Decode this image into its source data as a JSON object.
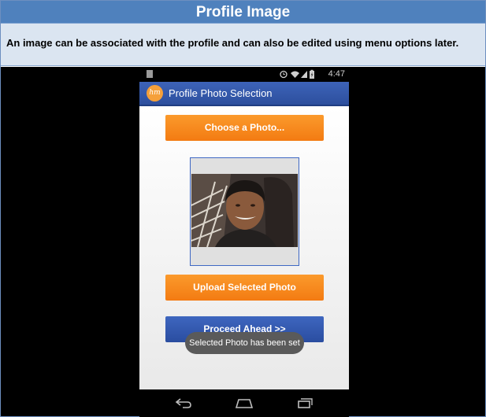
{
  "header": {
    "title": "Profile Image",
    "description": "An image can be associated with the profile and can also be edited using menu options later."
  },
  "status_bar": {
    "time": "4:47"
  },
  "app": {
    "logo_text": "hm",
    "title": "Profile Photo Selection",
    "choose_button_label": "Choose a Photo...",
    "upload_button_label": "Upload Selected Photo",
    "proceed_button_label": "Proceed Ahead >>",
    "toast_message": "Selected Photo has been set"
  },
  "icons": {
    "status": [
      "notification-icon",
      "alarm-icon",
      "wifi-icon",
      "signal-icon",
      "battery-icon"
    ],
    "nav": [
      "back-icon",
      "home-icon",
      "recent-apps-icon"
    ]
  },
  "colors": {
    "header_bg": "#4f81bd",
    "description_bg": "#dbe5f1",
    "action_bar": "#3a5fb3",
    "button_orange": "#f7891f",
    "button_blue": "#3158ae",
    "toast_bg": "#5a5a5a",
    "logo_orange": "#f5a03a"
  }
}
